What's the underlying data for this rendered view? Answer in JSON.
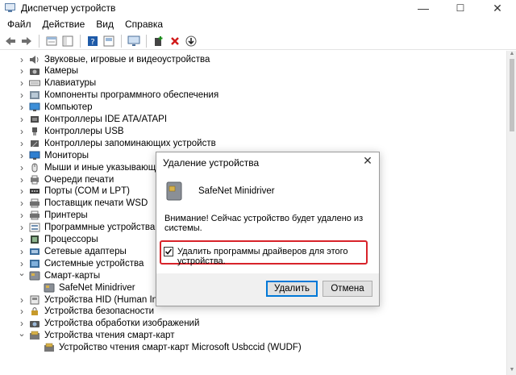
{
  "window": {
    "title": "Диспетчер устройств",
    "minimize": "—",
    "maximize": "☐",
    "close": "✕"
  },
  "menu": [
    "Файл",
    "Действие",
    "Вид",
    "Справка"
  ],
  "toolbar": {
    "icons": [
      "back-arrow-icon",
      "forward-arrow-icon",
      "properties-icon",
      "console-tree-icon",
      "help-icon",
      "show-hidden-icon",
      "monitor-scan-icon",
      "add-driver-icon",
      "delete-icon",
      "download-icon"
    ],
    "colors": {
      "delete": "#d11b1b",
      "add": "#1a8a1a"
    }
  },
  "tree": [
    {
      "label": "Звуковые, игровые и видеоустройства",
      "expanded": false,
      "icon": "speaker-icon",
      "level": 0
    },
    {
      "label": "Камеры",
      "expanded": false,
      "icon": "camera-icon",
      "level": 0
    },
    {
      "label": "Клавиатуры",
      "expanded": false,
      "icon": "keyboard-icon",
      "level": 0
    },
    {
      "label": "Компоненты программного обеспечения",
      "expanded": false,
      "icon": "software-component-icon",
      "level": 0
    },
    {
      "label": "Компьютер",
      "expanded": false,
      "icon": "computer-icon",
      "level": 0
    },
    {
      "label": "Контроллеры IDE ATA/ATAPI",
      "expanded": false,
      "icon": "ide-controller-icon",
      "level": 0
    },
    {
      "label": "Контроллеры USB",
      "expanded": false,
      "icon": "usb-icon",
      "level": 0
    },
    {
      "label": "Контроллеры запоминающих устройств",
      "expanded": false,
      "icon": "storage-controller-icon",
      "level": 0
    },
    {
      "label": "Мониторы",
      "expanded": false,
      "icon": "monitor-icon",
      "level": 0
    },
    {
      "label": "Мыши и иные указывающие у",
      "expanded": false,
      "icon": "mouse-icon",
      "level": 0
    },
    {
      "label": "Очереди печати",
      "expanded": false,
      "icon": "print-queue-icon",
      "level": 0
    },
    {
      "label": "Порты (COM и LPT)",
      "expanded": false,
      "icon": "port-icon",
      "level": 0
    },
    {
      "label": "Поставщик печати WSD",
      "expanded": false,
      "icon": "printer-icon",
      "level": 0
    },
    {
      "label": "Принтеры",
      "expanded": false,
      "icon": "printer-icon",
      "level": 0
    },
    {
      "label": "Программные устройства",
      "expanded": false,
      "icon": "software-device-icon",
      "level": 0
    },
    {
      "label": "Процессоры",
      "expanded": false,
      "icon": "processor-icon",
      "level": 0
    },
    {
      "label": "Сетевые адаптеры",
      "expanded": false,
      "icon": "network-adapter-icon",
      "level": 0
    },
    {
      "label": "Системные устройства",
      "expanded": false,
      "icon": "system-device-icon",
      "level": 0
    },
    {
      "label": "Смарт-карты",
      "expanded": true,
      "icon": "smart-card-icon",
      "level": 0
    },
    {
      "label": "SafeNet Minidriver",
      "expanded": null,
      "icon": "smart-card-icon",
      "level": 1
    },
    {
      "label": "Устройства HID (Human Interfa",
      "expanded": false,
      "icon": "hid-icon",
      "level": 0
    },
    {
      "label": "Устройства безопасности",
      "expanded": false,
      "icon": "security-device-icon",
      "level": 0
    },
    {
      "label": "Устройства обработки изображений",
      "expanded": false,
      "icon": "imaging-device-icon",
      "level": 0
    },
    {
      "label": "Устройства чтения смарт-карт",
      "expanded": true,
      "icon": "card-reader-icon",
      "level": 0
    },
    {
      "label": "Устройство чтения смарт-карт Microsoft Usbccid (WUDF)",
      "expanded": null,
      "icon": "card-reader-icon",
      "level": 1
    }
  ],
  "dialog": {
    "title": "Удаление устройства",
    "close": "✕",
    "device_name": "SafeNet Minidriver",
    "warning": "Внимание! Сейчас устройство будет удалено из системы.",
    "checkbox_label": "Удалить программы драйверов для этого устройства.",
    "checkbox_checked": true,
    "ok_label": "Удалить",
    "cancel_label": "Отмена",
    "highlight_color": "#d8232a"
  }
}
